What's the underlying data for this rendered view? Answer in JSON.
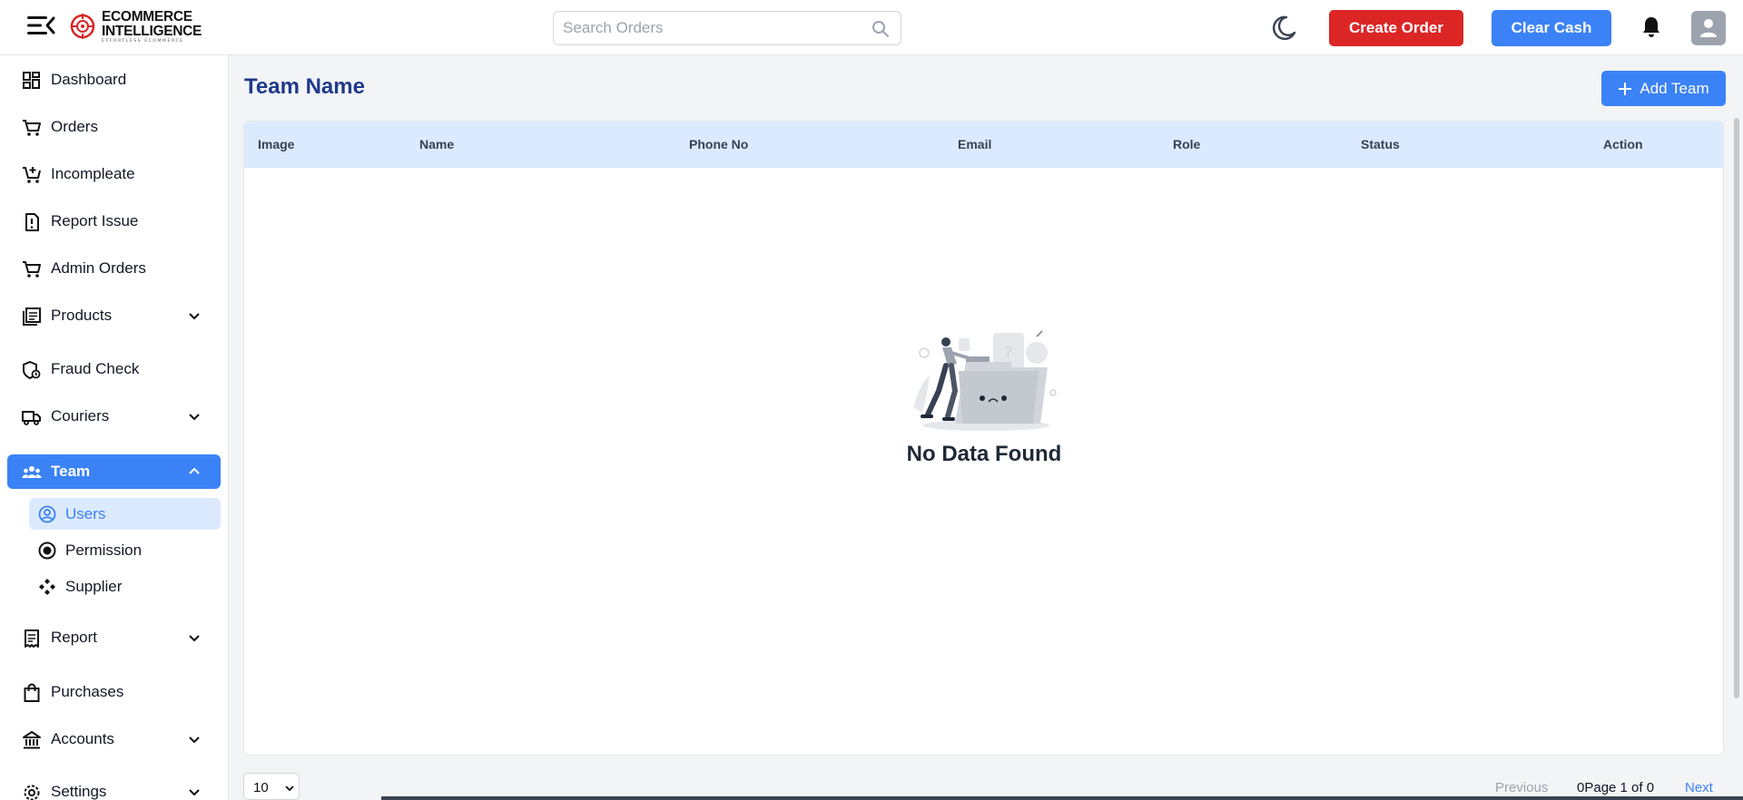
{
  "header": {
    "logo": {
      "line1": "ECOMMERCE",
      "line2": "INTELLIGENCE",
      "tagline": "EFFORTLESS ECOMMERCE"
    },
    "search": {
      "placeholder": "Search Orders",
      "value": ""
    },
    "create_order_label": "Create Order",
    "clear_cash_label": "Clear Cash",
    "colors": {
      "danger": "#dc2626",
      "primary": "#3b82f6"
    }
  },
  "sidebar": {
    "items": [
      {
        "label": "Dashboard",
        "icon": "dashboard-icon"
      },
      {
        "label": "Orders",
        "icon": "cart-icon"
      },
      {
        "label": "Incompleate",
        "icon": "cart-plus-icon"
      },
      {
        "label": "Report Issue",
        "icon": "report-issue-icon"
      },
      {
        "label": "Admin Orders",
        "icon": "cart-icon"
      },
      {
        "label": "Products",
        "icon": "products-icon",
        "expandable": true
      },
      {
        "label": "Fraud Check",
        "icon": "fraud-check-icon"
      },
      {
        "label": "Couriers",
        "icon": "truck-icon",
        "expandable": true
      },
      {
        "label": "Team",
        "icon": "team-icon",
        "expandable": true,
        "expanded": true,
        "active": true
      },
      {
        "label": "Report",
        "icon": "receipt-icon",
        "expandable": true
      },
      {
        "label": "Purchases",
        "icon": "bag-icon"
      },
      {
        "label": "Accounts",
        "icon": "bank-icon",
        "expandable": true
      },
      {
        "label": "Settings",
        "icon": "gear-icon",
        "expandable": true
      }
    ],
    "team_sub": [
      {
        "label": "Users",
        "icon": "user-circle-icon",
        "active": true
      },
      {
        "label": "Permission",
        "icon": "radio-icon"
      },
      {
        "label": "Supplier",
        "icon": "supplier-icon"
      }
    ]
  },
  "main": {
    "title": "Team Name",
    "add_button_label": "Add Team",
    "table": {
      "columns": [
        "Image",
        "Name",
        "Phone No",
        "Email",
        "Role",
        "Status",
        "Action"
      ],
      "rows": []
    },
    "empty_text": "No Data Found",
    "pagination": {
      "page_size": "10",
      "previous_label": "Previous",
      "info": "0Page 1 of 0",
      "next_label": "Next"
    }
  }
}
